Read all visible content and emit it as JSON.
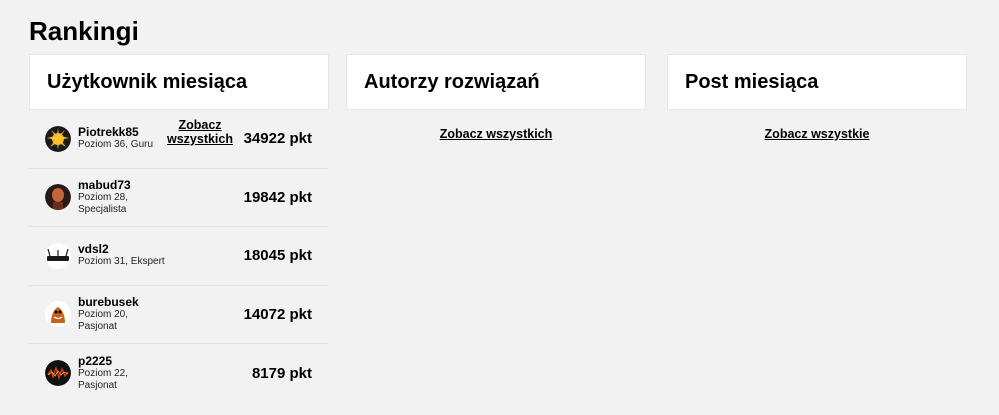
{
  "section": {
    "title": "Rankingi"
  },
  "columns": [
    {
      "title": "Użytkownik miesiąca",
      "more": "Zobacz wszystkich"
    },
    {
      "title": "Autorzy rozwiązań",
      "more": "Zobacz wszystkich"
    },
    {
      "title": "Post miesiąca",
      "more": "Zobacz wszystkie"
    }
  ],
  "users": [
    {
      "name": "Piotrekk85",
      "level": "Poziom 36, Guru",
      "points": "34922 pkt",
      "avatar_color": "#b5651d"
    },
    {
      "name": "mabud73",
      "level": "Poziom 28, Specjalista",
      "points": "19842 pkt",
      "avatar_color": "#8b3a2a"
    },
    {
      "name": "vdsl2",
      "level": "Poziom 31, Ekspert",
      "points": "18045 pkt",
      "avatar_color": "#222222"
    },
    {
      "name": "burebusek",
      "level": "Poziom 20, Pasjonat",
      "points": "14072 pkt",
      "avatar_color": "#c8621c"
    },
    {
      "name": "p2225",
      "level": "Poziom 22, Pasjonat",
      "points": "8179 pkt",
      "avatar_color": "#111111"
    }
  ],
  "colors": {
    "background": "#f2f2f2",
    "card": "#ffffff",
    "text": "#000000"
  }
}
